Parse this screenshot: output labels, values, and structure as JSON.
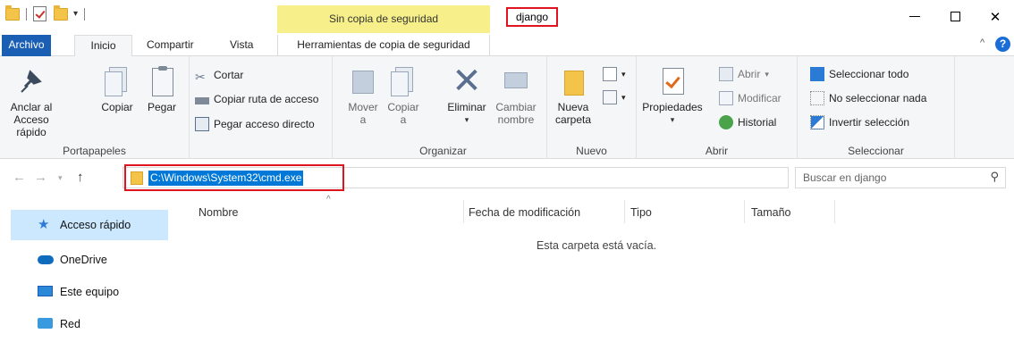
{
  "titlebar": {
    "context_tab_title": "Sin copia de seguridad",
    "window_title": "django",
    "minimize_symbol": "—",
    "close_symbol": "✕"
  },
  "ribbon_tabs": {
    "file": "Archivo",
    "home": "Inicio",
    "share": "Compartir",
    "view": "Vista",
    "backup_tools": "Herramientas de copia de seguridad"
  },
  "ribbon": {
    "clipboard": {
      "label": "Portapapeles",
      "pin": "Anclar al\nAcceso rápido",
      "copy": "Copiar",
      "paste": "Pegar",
      "cut": "Cortar",
      "copy_path": "Copiar ruta de acceso",
      "paste_shortcut": "Pegar acceso directo"
    },
    "organize": {
      "label": "Organizar",
      "move_to": "Mover\na",
      "copy_to": "Copiar\na",
      "delete": "Eliminar",
      "rename": "Cambiar\nnombre"
    },
    "new": {
      "label": "Nuevo",
      "new_folder": "Nueva\ncarpeta"
    },
    "open": {
      "label": "Abrir",
      "properties": "Propiedades",
      "open": "Abrir",
      "edit": "Modificar",
      "history": "Historial"
    },
    "select": {
      "label": "Seleccionar",
      "select_all": "Seleccionar todo",
      "select_none": "No seleccionar nada",
      "invert": "Invertir selección"
    }
  },
  "address": {
    "path": "C:\\Windows\\System32\\cmd.exe",
    "search_placeholder": "Buscar en django"
  },
  "nav_pane": {
    "items": [
      {
        "label": "Acceso rápido",
        "icon": "star-icon"
      },
      {
        "label": "OneDrive",
        "icon": "cloud-icon"
      },
      {
        "label": "Este equipo",
        "icon": "computer-icon"
      },
      {
        "label": "Red",
        "icon": "network-icon"
      }
    ]
  },
  "file_list": {
    "columns": [
      "Nombre",
      "Fecha de modificación",
      "Tipo",
      "Tamaño"
    ],
    "empty_message": "Esta carpeta está vacía."
  },
  "colors": {
    "accent": "#0078d7",
    "file_tab": "#1a5fb4",
    "context_tab": "#f7f08a",
    "highlight_border": "#e0141e",
    "selected_nav": "#cce8ff"
  }
}
